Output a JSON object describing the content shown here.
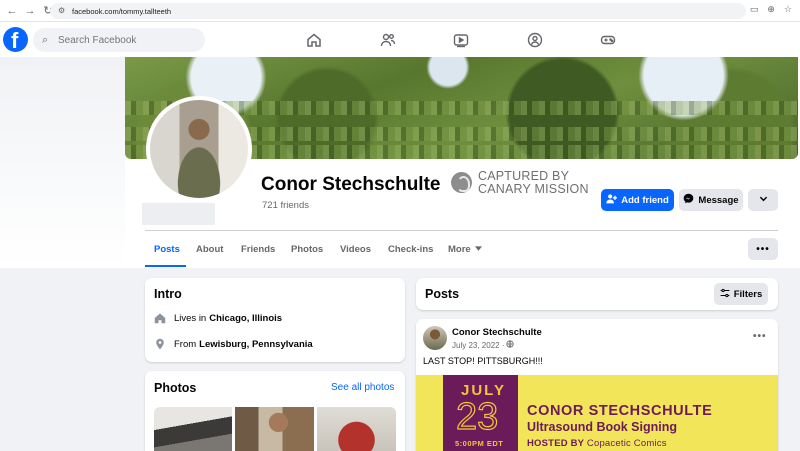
{
  "browser": {
    "url": "facebook.com/tommy.tallteeth"
  },
  "nav": {
    "search_placeholder": "Search Facebook",
    "icons": [
      "home-icon",
      "friends-icon",
      "watch-icon",
      "groups-icon",
      "gaming-icon"
    ]
  },
  "profile": {
    "name": "Conor Stechschulte",
    "friends": "721 friends",
    "watermark_line1": "CAPTURED BY",
    "watermark_line2": "CANARY MISSION",
    "add_friend_label": "Add friend",
    "message_label": "Message"
  },
  "tabs": [
    "Posts",
    "About",
    "Friends",
    "Photos",
    "Videos",
    "Check-ins",
    "More"
  ],
  "intro": {
    "title": "Intro",
    "lives_prefix": "Lives in",
    "lives_city": "Chicago, Illinois",
    "from_prefix": "From",
    "from_city": "Lewisburg, Pennsylvania"
  },
  "photos": {
    "title": "Photos",
    "see_all_label": "See all photos"
  },
  "posts": {
    "title": "Posts",
    "filters_label": "Filters",
    "post": {
      "author": "Conor Stechschulte",
      "date": "July 23, 2022 ·",
      "text": "LAST STOP! PITTSBURGH!!!",
      "image": {
        "month": "JULY",
        "day": "23",
        "time": "5:00PM EDT",
        "headline": "CONOR STECHSCHULTE",
        "subheadline": "Ultrasound Book Signing",
        "hosted_prefix": "HOSTED BY",
        "hosted_by": "Copacetic Comics"
      }
    }
  },
  "colors": {
    "accent": "#0866ff",
    "poster_yellow": "#f3e55a",
    "poster_purple": "#6b1a5a"
  }
}
